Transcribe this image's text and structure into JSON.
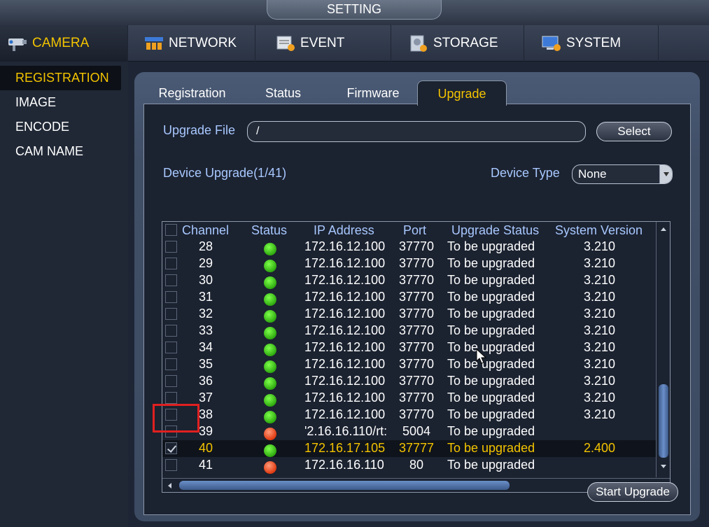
{
  "title": "SETTING",
  "main_tabs": [
    {
      "label": "CAMERA",
      "icon": "camera-icon",
      "active": true
    },
    {
      "label": "NETWORK",
      "icon": "network-icon",
      "active": false
    },
    {
      "label": "EVENT",
      "icon": "event-icon",
      "active": false
    },
    {
      "label": "STORAGE",
      "icon": "storage-icon",
      "active": false
    },
    {
      "label": "SYSTEM",
      "icon": "system-icon",
      "active": false
    }
  ],
  "side_menu": [
    {
      "label": "REGISTRATION",
      "active": true
    },
    {
      "label": "IMAGE",
      "active": false
    },
    {
      "label": "ENCODE",
      "active": false
    },
    {
      "label": "CAM NAME",
      "active": false
    }
  ],
  "sub_tabs": [
    {
      "label": "Registration",
      "active": false
    },
    {
      "label": "Status",
      "active": false
    },
    {
      "label": "Firmware",
      "active": false
    },
    {
      "label": "Upgrade",
      "active": true
    }
  ],
  "upgrade": {
    "file_label": "Upgrade File",
    "file_value": "/",
    "select_label": "Select",
    "device_upgrade_label": "Device Upgrade(1/41)",
    "device_type_label": "Device Type",
    "device_type_value": "None",
    "start_label": "Start Upgrade"
  },
  "table": {
    "headers": [
      "Channel",
      "Status",
      "IP Address",
      "Port",
      "Upgrade Status",
      "System Version"
    ],
    "rows": [
      {
        "checked": false,
        "channel": "28",
        "status": "green",
        "ip": "172.16.12.100",
        "port": "37770",
        "upgrade_status": "To be upgraded",
        "version": "3.210",
        "selected": false
      },
      {
        "checked": false,
        "channel": "29",
        "status": "green",
        "ip": "172.16.12.100",
        "port": "37770",
        "upgrade_status": "To be upgraded",
        "version": "3.210",
        "selected": false
      },
      {
        "checked": false,
        "channel": "30",
        "status": "green",
        "ip": "172.16.12.100",
        "port": "37770",
        "upgrade_status": "To be upgraded",
        "version": "3.210",
        "selected": false
      },
      {
        "checked": false,
        "channel": "31",
        "status": "green",
        "ip": "172.16.12.100",
        "port": "37770",
        "upgrade_status": "To be upgraded",
        "version": "3.210",
        "selected": false
      },
      {
        "checked": false,
        "channel": "32",
        "status": "green",
        "ip": "172.16.12.100",
        "port": "37770",
        "upgrade_status": "To be upgraded",
        "version": "3.210",
        "selected": false
      },
      {
        "checked": false,
        "channel": "33",
        "status": "green",
        "ip": "172.16.12.100",
        "port": "37770",
        "upgrade_status": "To be upgraded",
        "version": "3.210",
        "selected": false
      },
      {
        "checked": false,
        "channel": "34",
        "status": "green",
        "ip": "172.16.12.100",
        "port": "37770",
        "upgrade_status": "To be upgraded",
        "version": "3.210",
        "selected": false
      },
      {
        "checked": false,
        "channel": "35",
        "status": "green",
        "ip": "172.16.12.100",
        "port": "37770",
        "upgrade_status": "To be upgraded",
        "version": "3.210",
        "selected": false
      },
      {
        "checked": false,
        "channel": "36",
        "status": "green",
        "ip": "172.16.12.100",
        "port": "37770",
        "upgrade_status": "To be upgraded",
        "version": "3.210",
        "selected": false
      },
      {
        "checked": false,
        "channel": "37",
        "status": "green",
        "ip": "172.16.12.100",
        "port": "37770",
        "upgrade_status": "To be upgraded",
        "version": "3.210",
        "selected": false
      },
      {
        "checked": false,
        "channel": "38",
        "status": "green",
        "ip": "172.16.12.100",
        "port": "37770",
        "upgrade_status": "To be upgraded",
        "version": "3.210",
        "selected": false
      },
      {
        "checked": false,
        "channel": "39",
        "status": "red",
        "ip": "'2.16.16.110/rt:",
        "port": "5004",
        "upgrade_status": "To be upgraded",
        "version": "",
        "selected": false
      },
      {
        "checked": true,
        "channel": "40",
        "status": "green",
        "ip": "172.16.17.105",
        "port": "37777",
        "upgrade_status": "To be upgraded",
        "version": "2.400",
        "selected": true
      },
      {
        "checked": false,
        "channel": "41",
        "status": "red",
        "ip": "172.16.16.110",
        "port": "80",
        "upgrade_status": "To be upgraded",
        "version": "",
        "selected": false
      }
    ]
  },
  "colors": {
    "accent": "#f3c300",
    "label_blue": "#a8c8ff",
    "status_green": "#2faa10",
    "status_red": "#e03a10",
    "highlight_red": "#e02020"
  }
}
